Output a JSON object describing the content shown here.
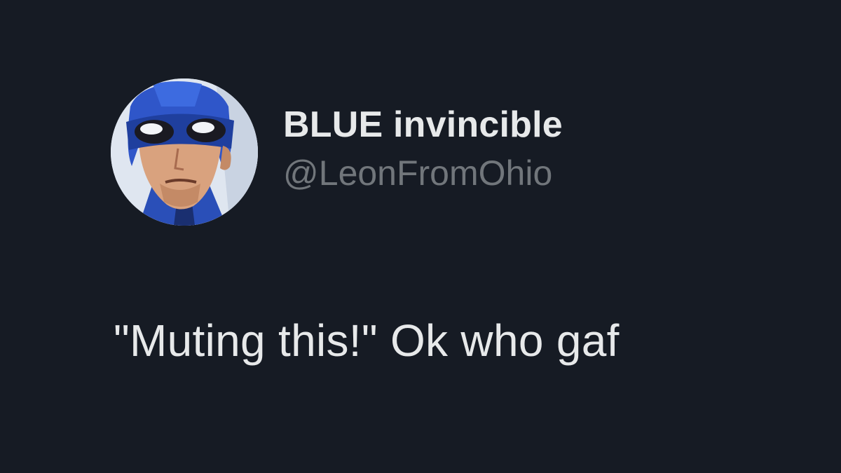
{
  "tweet": {
    "author": {
      "display_name": "BLUE invincible",
      "handle": "@LeonFromOhio",
      "avatar_icon": "masked-hero-avatar"
    },
    "text": "\"Muting this!\" Ok who gaf"
  },
  "colors": {
    "background": "#161b24",
    "primary_text": "#e7e9ea",
    "secondary_text": "#71767b",
    "avatar_blue": "#2f56c9"
  }
}
